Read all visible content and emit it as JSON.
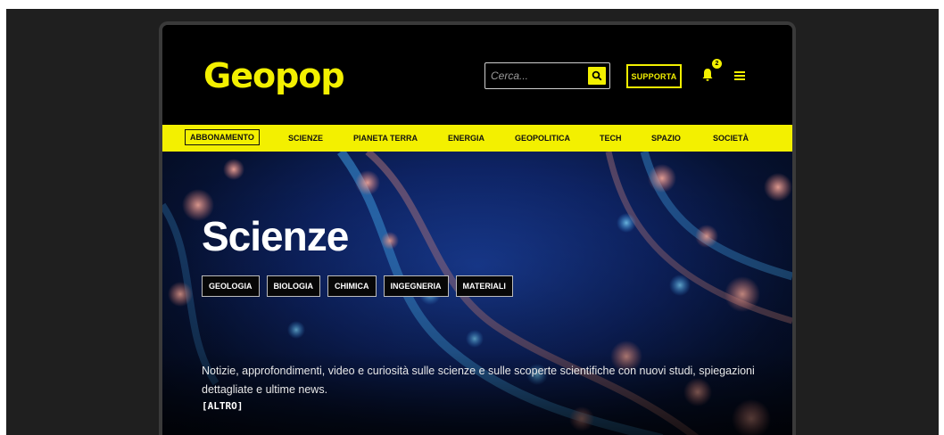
{
  "brand": {
    "logo_text": "Geopop",
    "accent": "#f3f000"
  },
  "search": {
    "placeholder": "Cerca...",
    "icon": "search-icon"
  },
  "header": {
    "support_label": "SUPPORTA",
    "notification_count": "2",
    "menu_icon": "hamburger-icon"
  },
  "nav": {
    "items": [
      {
        "label": "ABBONAMENTO"
      },
      {
        "label": "SCIENZE"
      },
      {
        "label": "PIANETA TERRA"
      },
      {
        "label": "ENERGIA"
      },
      {
        "label": "GEOPOLITICA"
      },
      {
        "label": "TECH"
      },
      {
        "label": "SPAZIO"
      },
      {
        "label": "SOCIETÀ"
      }
    ]
  },
  "hero": {
    "title": "Scienze",
    "tags": [
      "GEOLOGIA",
      "BIOLOGIA",
      "CHIMICA",
      "INGEGNERIA",
      "MATERIALI"
    ],
    "description": "Notizie, approfondimenti, video e curiosità sulle scienze e sulle scoperte scientifiche con nuovi studi, spiegazioni dettagliate e ultime news.",
    "more_label": "[ALTRO]"
  }
}
